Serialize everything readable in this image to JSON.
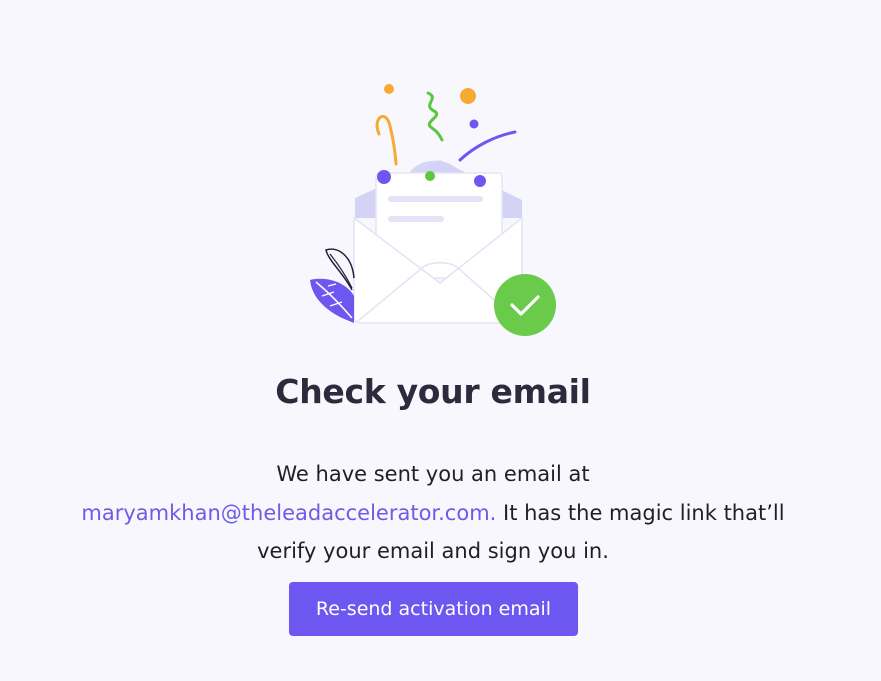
{
  "heading": "Check your email",
  "message": {
    "line1": "We have sent you an email at",
    "email": "maryamkhan@theleadaccelerator.com.",
    "line2_rest": " It has the magic link that’ll",
    "line3": "verify your email and sign you in."
  },
  "resend_button_label": "Re-send activation email",
  "colors": {
    "background": "#f7f7fd",
    "accent": "#6e56f0",
    "link": "#6c5ce7",
    "success": "#6acb4a",
    "confetti_orange": "#f5ab33"
  },
  "icons": {
    "illustration": "open-envelope-illustration",
    "check": "check-icon",
    "leaf": "leaf-icon"
  }
}
